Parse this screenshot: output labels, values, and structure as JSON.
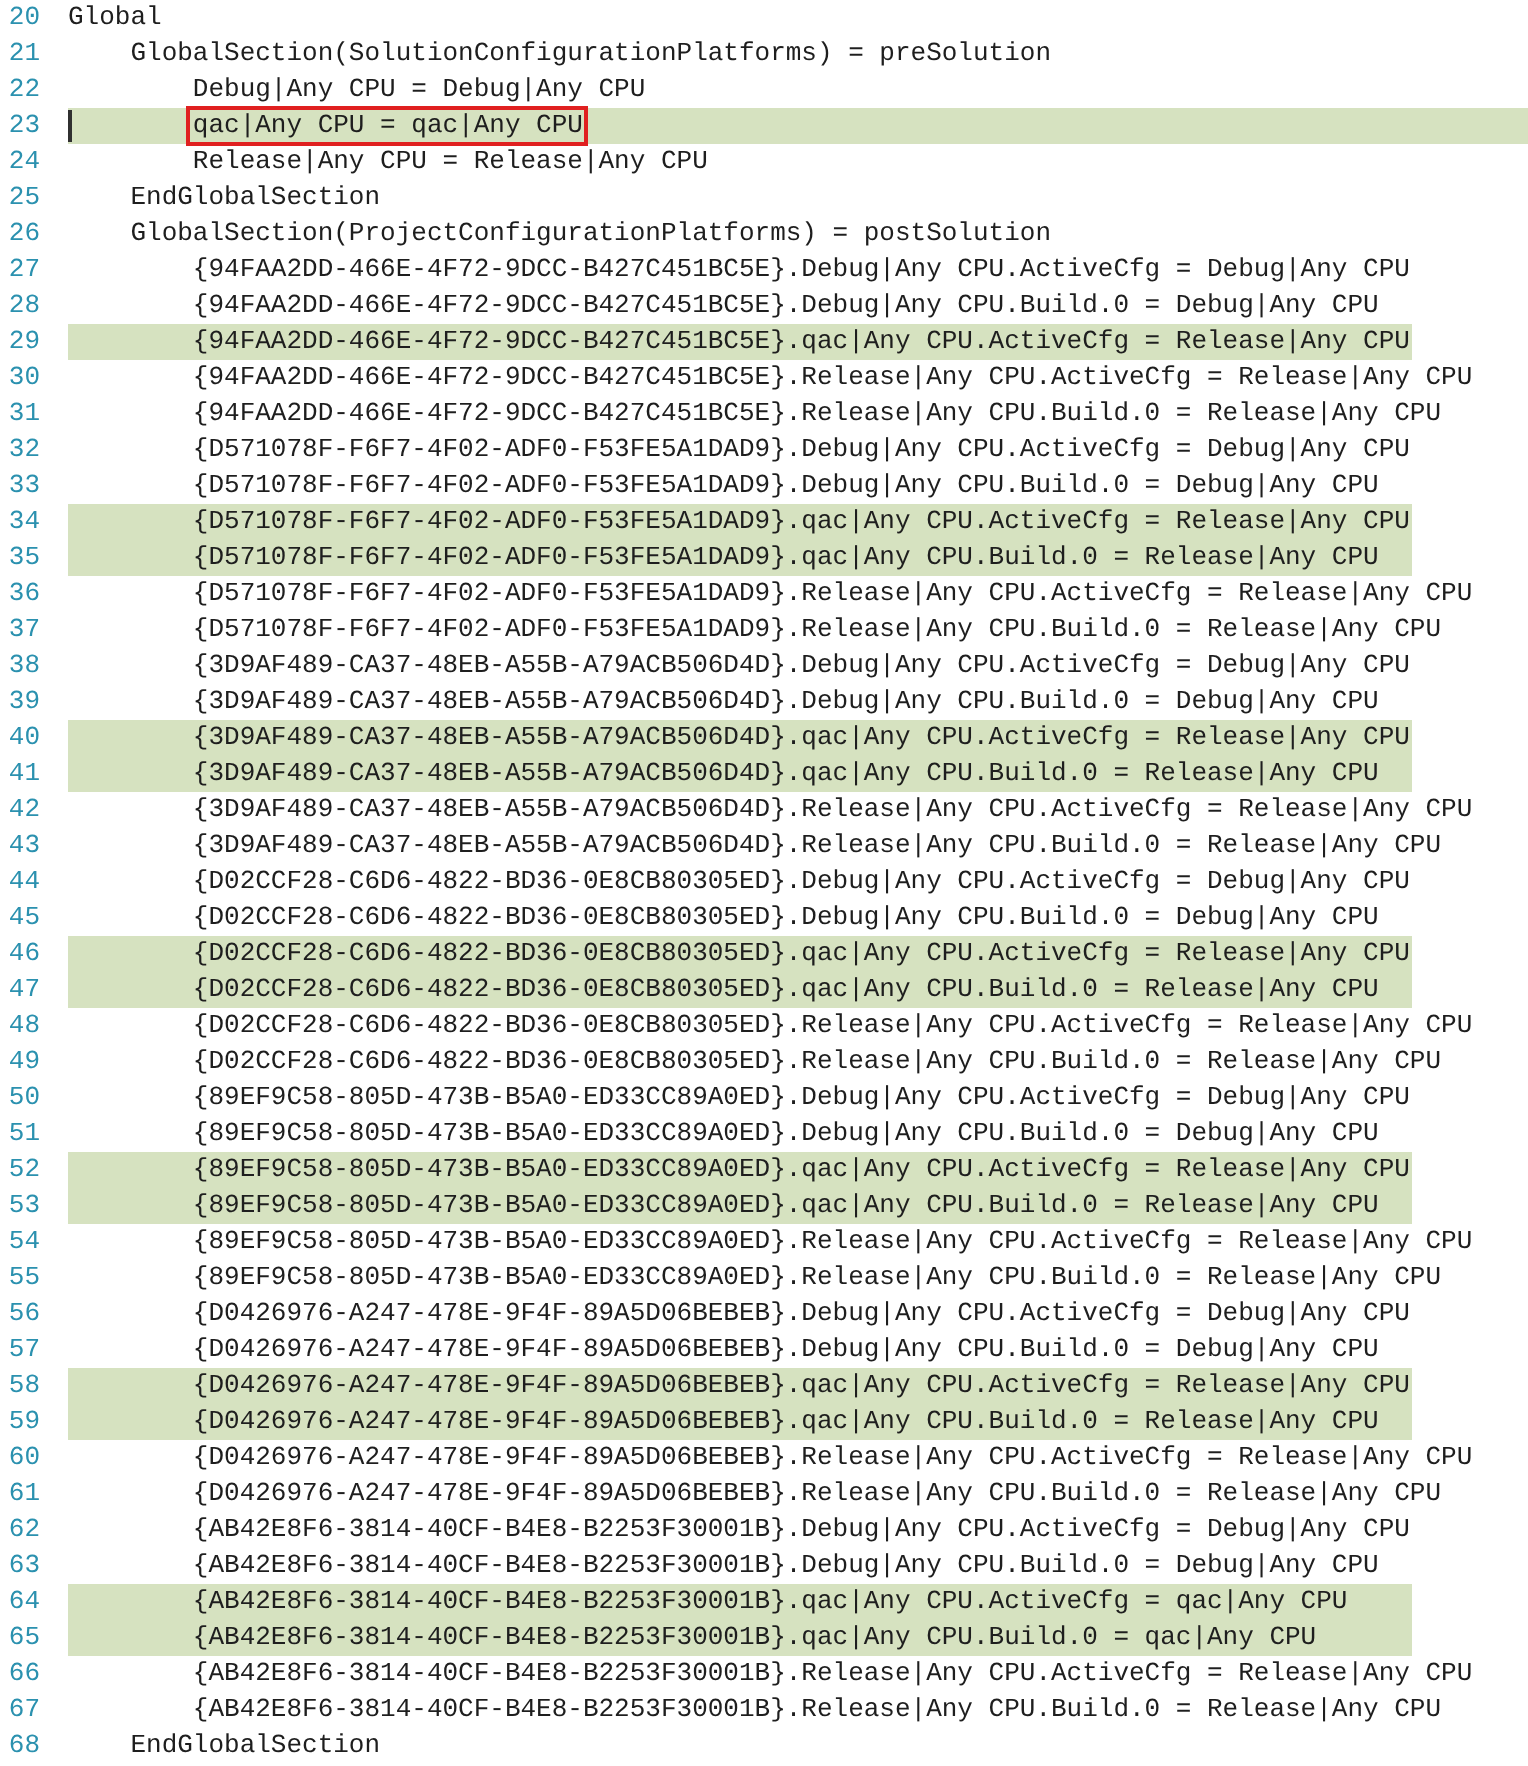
{
  "lines": [
    {
      "number": "20",
      "text": "Global",
      "highlighted": false
    },
    {
      "number": "21",
      "text": "    GlobalSection(SolutionConfigurationPlatforms) = preSolution",
      "highlighted": false
    },
    {
      "number": "22",
      "text": "        Debug|Any CPU = Debug|Any CPU",
      "highlighted": false
    },
    {
      "number": "23",
      "text": "        qac|Any CPU = qac|Any CPU",
      "highlighted": true,
      "cursor": true,
      "boxed": true
    },
    {
      "number": "24",
      "text": "        Release|Any CPU = Release|Any CPU",
      "highlighted": false
    },
    {
      "number": "25",
      "text": "    EndGlobalSection",
      "highlighted": false
    },
    {
      "number": "26",
      "text": "    GlobalSection(ProjectConfigurationPlatforms) = postSolution",
      "highlighted": false
    },
    {
      "number": "27",
      "text": "        {94FAA2DD-466E-4F72-9DCC-B427C451BC5E}.Debug|Any CPU.ActiveCfg = Debug|Any CPU",
      "highlighted": false
    },
    {
      "number": "28",
      "text": "        {94FAA2DD-466E-4F72-9DCC-B427C451BC5E}.Debug|Any CPU.Build.0 = Debug|Any CPU",
      "highlighted": false
    },
    {
      "number": "29",
      "text": "        {94FAA2DD-466E-4F72-9DCC-B427C451BC5E}.qac|Any CPU.ActiveCfg = Release|Any CPU",
      "highlighted": true
    },
    {
      "number": "30",
      "text": "        {94FAA2DD-466E-4F72-9DCC-B427C451BC5E}.Release|Any CPU.ActiveCfg = Release|Any CPU",
      "highlighted": false
    },
    {
      "number": "31",
      "text": "        {94FAA2DD-466E-4F72-9DCC-B427C451BC5E}.Release|Any CPU.Build.0 = Release|Any CPU",
      "highlighted": false
    },
    {
      "number": "32",
      "text": "        {D571078F-F6F7-4F02-ADF0-F53FE5A1DAD9}.Debug|Any CPU.ActiveCfg = Debug|Any CPU",
      "highlighted": false
    },
    {
      "number": "33",
      "text": "        {D571078F-F6F7-4F02-ADF0-F53FE5A1DAD9}.Debug|Any CPU.Build.0 = Debug|Any CPU",
      "highlighted": false
    },
    {
      "number": "34",
      "text": "        {D571078F-F6F7-4F02-ADF0-F53FE5A1DAD9}.qac|Any CPU.ActiveCfg = Release|Any CPU",
      "highlighted": true
    },
    {
      "number": "35",
      "text": "        {D571078F-F6F7-4F02-ADF0-F53FE5A1DAD9}.qac|Any CPU.Build.0 = Release|Any CPU",
      "highlighted": true
    },
    {
      "number": "36",
      "text": "        {D571078F-F6F7-4F02-ADF0-F53FE5A1DAD9}.Release|Any CPU.ActiveCfg = Release|Any CPU",
      "highlighted": false
    },
    {
      "number": "37",
      "text": "        {D571078F-F6F7-4F02-ADF0-F53FE5A1DAD9}.Release|Any CPU.Build.0 = Release|Any CPU",
      "highlighted": false
    },
    {
      "number": "38",
      "text": "        {3D9AF489-CA37-48EB-A55B-A79ACB506D4D}.Debug|Any CPU.ActiveCfg = Debug|Any CPU",
      "highlighted": false
    },
    {
      "number": "39",
      "text": "        {3D9AF489-CA37-48EB-A55B-A79ACB506D4D}.Debug|Any CPU.Build.0 = Debug|Any CPU",
      "highlighted": false
    },
    {
      "number": "40",
      "text": "        {3D9AF489-CA37-48EB-A55B-A79ACB506D4D}.qac|Any CPU.ActiveCfg = Release|Any CPU",
      "highlighted": true
    },
    {
      "number": "41",
      "text": "        {3D9AF489-CA37-48EB-A55B-A79ACB506D4D}.qac|Any CPU.Build.0 = Release|Any CPU",
      "highlighted": true
    },
    {
      "number": "42",
      "text": "        {3D9AF489-CA37-48EB-A55B-A79ACB506D4D}.Release|Any CPU.ActiveCfg = Release|Any CPU",
      "highlighted": false
    },
    {
      "number": "43",
      "text": "        {3D9AF489-CA37-48EB-A55B-A79ACB506D4D}.Release|Any CPU.Build.0 = Release|Any CPU",
      "highlighted": false
    },
    {
      "number": "44",
      "text": "        {D02CCF28-C6D6-4822-BD36-0E8CB80305ED}.Debug|Any CPU.ActiveCfg = Debug|Any CPU",
      "highlighted": false
    },
    {
      "number": "45",
      "text": "        {D02CCF28-C6D6-4822-BD36-0E8CB80305ED}.Debug|Any CPU.Build.0 = Debug|Any CPU",
      "highlighted": false
    },
    {
      "number": "46",
      "text": "        {D02CCF28-C6D6-4822-BD36-0E8CB80305ED}.qac|Any CPU.ActiveCfg = Release|Any CPU",
      "highlighted": true
    },
    {
      "number": "47",
      "text": "        {D02CCF28-C6D6-4822-BD36-0E8CB80305ED}.qac|Any CPU.Build.0 = Release|Any CPU",
      "highlighted": true
    },
    {
      "number": "48",
      "text": "        {D02CCF28-C6D6-4822-BD36-0E8CB80305ED}.Release|Any CPU.ActiveCfg = Release|Any CPU",
      "highlighted": false
    },
    {
      "number": "49",
      "text": "        {D02CCF28-C6D6-4822-BD36-0E8CB80305ED}.Release|Any CPU.Build.0 = Release|Any CPU",
      "highlighted": false
    },
    {
      "number": "50",
      "text": "        {89EF9C58-805D-473B-B5A0-ED33CC89A0ED}.Debug|Any CPU.ActiveCfg = Debug|Any CPU",
      "highlighted": false
    },
    {
      "number": "51",
      "text": "        {89EF9C58-805D-473B-B5A0-ED33CC89A0ED}.Debug|Any CPU.Build.0 = Debug|Any CPU",
      "highlighted": false
    },
    {
      "number": "52",
      "text": "        {89EF9C58-805D-473B-B5A0-ED33CC89A0ED}.qac|Any CPU.ActiveCfg = Release|Any CPU",
      "highlighted": true
    },
    {
      "number": "53",
      "text": "        {89EF9C58-805D-473B-B5A0-ED33CC89A0ED}.qac|Any CPU.Build.0 = Release|Any CPU",
      "highlighted": true
    },
    {
      "number": "54",
      "text": "        {89EF9C58-805D-473B-B5A0-ED33CC89A0ED}.Release|Any CPU.ActiveCfg = Release|Any CPU",
      "highlighted": false
    },
    {
      "number": "55",
      "text": "        {89EF9C58-805D-473B-B5A0-ED33CC89A0ED}.Release|Any CPU.Build.0 = Release|Any CPU",
      "highlighted": false
    },
    {
      "number": "56",
      "text": "        {D0426976-A247-478E-9F4F-89A5D06BEBEB}.Debug|Any CPU.ActiveCfg = Debug|Any CPU",
      "highlighted": false
    },
    {
      "number": "57",
      "text": "        {D0426976-A247-478E-9F4F-89A5D06BEBEB}.Debug|Any CPU.Build.0 = Debug|Any CPU",
      "highlighted": false
    },
    {
      "number": "58",
      "text": "        {D0426976-A247-478E-9F4F-89A5D06BEBEB}.qac|Any CPU.ActiveCfg = Release|Any CPU",
      "highlighted": true
    },
    {
      "number": "59",
      "text": "        {D0426976-A247-478E-9F4F-89A5D06BEBEB}.qac|Any CPU.Build.0 = Release|Any CPU",
      "highlighted": true
    },
    {
      "number": "60",
      "text": "        {D0426976-A247-478E-9F4F-89A5D06BEBEB}.Release|Any CPU.ActiveCfg = Release|Any CPU",
      "highlighted": false
    },
    {
      "number": "61",
      "text": "        {D0426976-A247-478E-9F4F-89A5D06BEBEB}.Release|Any CPU.Build.0 = Release|Any CPU",
      "highlighted": false
    },
    {
      "number": "62",
      "text": "        {AB42E8F6-3814-40CF-B4E8-B2253F30001B}.Debug|Any CPU.ActiveCfg = Debug|Any CPU",
      "highlighted": false
    },
    {
      "number": "63",
      "text": "        {AB42E8F6-3814-40CF-B4E8-B2253F30001B}.Debug|Any CPU.Build.0 = Debug|Any CPU",
      "highlighted": false
    },
    {
      "number": "64",
      "text": "        {AB42E8F6-3814-40CF-B4E8-B2253F30001B}.qac|Any CPU.ActiveCfg = qac|Any CPU",
      "highlighted": true
    },
    {
      "number": "65",
      "text": "        {AB42E8F6-3814-40CF-B4E8-B2253F30001B}.qac|Any CPU.Build.0 = qac|Any CPU",
      "highlighted": true
    },
    {
      "number": "66",
      "text": "        {AB42E8F6-3814-40CF-B4E8-B2253F30001B}.Release|Any CPU.ActiveCfg = Release|Any CPU",
      "highlighted": false
    },
    {
      "number": "67",
      "text": "        {AB42E8F6-3814-40CF-B4E8-B2253F30001B}.Release|Any CPU.Build.0 = Release|Any CPU",
      "highlighted": false
    },
    {
      "number": "68",
      "text": "    EndGlobalSection",
      "highlighted": false
    }
  ]
}
